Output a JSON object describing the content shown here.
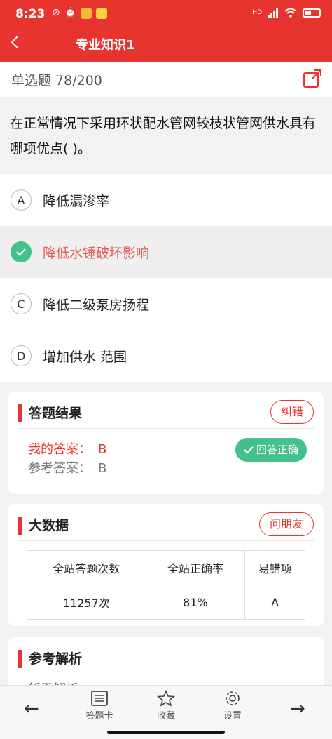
{
  "status": {
    "time": "8:23",
    "network": "HD",
    "icons": [
      "no-sound-icon",
      "alarm-icon",
      "app-notification-icon",
      "weibo-icon"
    ]
  },
  "header": {
    "title": "专业知识1"
  },
  "question": {
    "type_label": "单选题 78/200",
    "text": "在正常情况下采用环状配水管网较枝状管网供水具有哪项优点( )。",
    "options": [
      {
        "letter": "A",
        "text": "降低漏渗率"
      },
      {
        "letter": "B",
        "text": "降低水锤破坏影响",
        "selected_correct": true
      },
      {
        "letter": "C",
        "text": "降低二级泵房扬程"
      },
      {
        "letter": "D",
        "text": "增加供水 范围"
      }
    ]
  },
  "result": {
    "title": "答题结果",
    "report_button": "纠错",
    "my_answer_label": "我的答案：",
    "my_answer": "B",
    "ref_answer_label": "参考答案：",
    "ref_answer": "B",
    "badge": "回答正确"
  },
  "bigdata": {
    "title": "大数据",
    "ask_button": "问朋友",
    "headers": [
      "全站答题次数",
      "全站正确率",
      "易错项"
    ],
    "values": [
      "11257次",
      "81%",
      "A"
    ]
  },
  "analysis": {
    "title": "参考解析",
    "peek_text": "暂无解析"
  },
  "tabbar": {
    "prev": "←",
    "next": "→",
    "items": [
      {
        "label": "答题卡",
        "icon": "list-icon"
      },
      {
        "label": "收藏",
        "icon": "star-icon"
      },
      {
        "label": "设置",
        "icon": "gear-icon"
      }
    ]
  },
  "colors": {
    "brand": "#e8342e",
    "correct": "#43c08c"
  }
}
